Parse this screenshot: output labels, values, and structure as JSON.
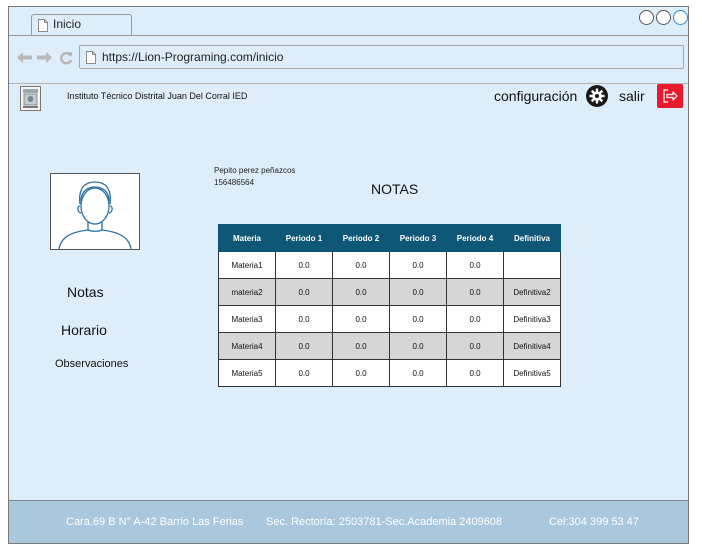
{
  "browser": {
    "tab_title": "Inicio",
    "url": "https://Lion-Programing.com/inicio"
  },
  "header": {
    "school_name": "Instituto Técnico Distrital Juan Del Corral IED",
    "config_label": "configuración",
    "logout_label": "salir"
  },
  "sidebar": {
    "items": [
      "Notas",
      "Horario",
      "Observaciones"
    ]
  },
  "student": {
    "name": "Pepito perez peñazcos",
    "id": "156486564"
  },
  "main": {
    "title": "NOTAS"
  },
  "grades": {
    "headers": [
      "Materia",
      "Periodo 1",
      "Periodo 2",
      "Periodo 3",
      "Periodo 4",
      "Definitiva"
    ],
    "rows": [
      [
        "Materia1",
        "0.0",
        "0.0",
        "0.0",
        "0.0",
        ""
      ],
      [
        "materia2",
        "0.0",
        "0.0",
        "0.0",
        "0.0",
        "Definitiva2"
      ],
      [
        "Materia3",
        "0.0",
        "0.0",
        "0.0",
        "0.0",
        "Definitiva3"
      ],
      [
        "Materia4",
        "0.0",
        "0.0",
        "0.0",
        "0.0",
        "Definitiva4"
      ],
      [
        "Materia5",
        "0.0",
        "0.0",
        "0.0",
        "0.0",
        "Definitiva5"
      ]
    ]
  },
  "footer": {
    "address": "Cara.69 B N° A-42 Barrio Las Ferias",
    "phones": "Sec. Rectoría: 2503781-Sec.Academia 2409608",
    "cel": "Cel:304 399 53 47"
  },
  "colors": {
    "table_header": "#0f5776",
    "page_bg": "#ddeefa",
    "footer_bg": "#a9c7dd",
    "exit_button": "#e8192c"
  },
  "icons": [
    "page-icon",
    "back-arrow-icon",
    "forward-arrow-icon",
    "reload-icon",
    "school-logo",
    "gear-icon",
    "exit-icon",
    "user-avatar-icon"
  ]
}
